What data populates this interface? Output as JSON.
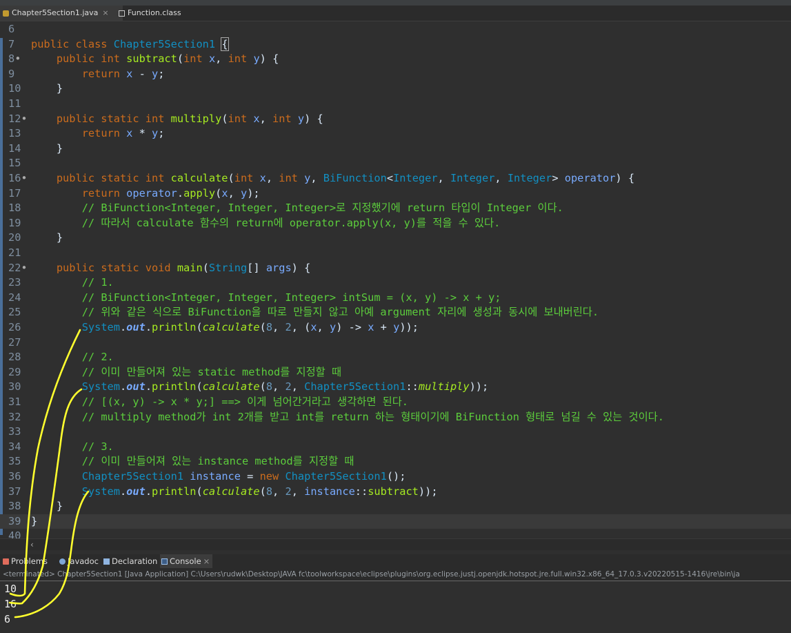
{
  "tabs": [
    {
      "label": "Chapter5Section1.java",
      "active": true,
      "closable": true,
      "icon": "java-file-icon"
    },
    {
      "label": "Function.class",
      "active": false,
      "closable": false,
      "icon": "class-file-icon"
    }
  ],
  "code_lines": [
    {
      "n": "6",
      "html": ""
    },
    {
      "n": "7",
      "html": "<span class=\"kw\">public class</span> <span class=\"ty\">Chapter5Section1</span> <span style=\"outline:1px solid #aaa\">{</span>"
    },
    {
      "n": "8",
      "fold": true,
      "html": "    <span class=\"kw\">public int</span> <span class=\"fn\">subtract</span>(<span class=\"kw\">int</span> <span class=\"va\">x</span>, <span class=\"kw\">int</span> <span class=\"va\">y</span>) {"
    },
    {
      "n": "9",
      "html": "        <span class=\"kw\">return</span> <span class=\"va\">x</span> - <span class=\"va\">y</span>;"
    },
    {
      "n": "10",
      "html": "    }"
    },
    {
      "n": "11",
      "html": ""
    },
    {
      "n": "12",
      "fold": true,
      "html": "    <span class=\"kw\">public static int</span> <span class=\"fn\">multiply</span>(<span class=\"kw\">int</span> <span class=\"va\">x</span>, <span class=\"kw\">int</span> <span class=\"va\">y</span>) {"
    },
    {
      "n": "13",
      "html": "        <span class=\"kw\">return</span> <span class=\"va\">x</span> * <span class=\"va\">y</span>;"
    },
    {
      "n": "14",
      "html": "    }"
    },
    {
      "n": "15",
      "html": ""
    },
    {
      "n": "16",
      "fold": true,
      "html": "    <span class=\"kw\">public static int</span> <span class=\"fn\">calculate</span>(<span class=\"kw\">int</span> <span class=\"va\">x</span>, <span class=\"kw\">int</span> <span class=\"va\">y</span>, <span class=\"ty\">BiFunction</span>&lt;<span class=\"ty\">Integer</span>, <span class=\"ty\">Integer</span>, <span class=\"ty\">Integer</span>&gt; <span class=\"va\">operator</span>) {"
    },
    {
      "n": "17",
      "html": "        <span class=\"kw\">return</span> <span class=\"va\">operator</span>.<span class=\"fn\">apply</span>(<span class=\"va\">x</span>, <span class=\"va\">y</span>);"
    },
    {
      "n": "18",
      "html": "        <span class=\"cm\">// BiFunction&lt;Integer, Integer, Integer&gt;로 지정했기에 return 타입이 Integer 이다.</span>"
    },
    {
      "n": "19",
      "html": "        <span class=\"cm\">// 따라서 calculate 함수의 return에 operator.apply(x, y)를 적을 수 있다.</span>"
    },
    {
      "n": "20",
      "html": "    }"
    },
    {
      "n": "21",
      "html": ""
    },
    {
      "n": "22",
      "fold": true,
      "html": "    <span class=\"kw\">public static void</span> <span class=\"fn\">main</span>(<span class=\"ty\">String</span>[] <span class=\"va\">args</span>) {"
    },
    {
      "n": "23",
      "html": "        <span class=\"cm\">// 1.</span>"
    },
    {
      "n": "24",
      "html": "        <span class=\"cm\">// BiFunction&lt;Integer, Integer, Integer&gt; intSum = (x, y) -&gt; x + y;</span>"
    },
    {
      "n": "25",
      "html": "        <span class=\"cm\">// 위와 같은 식으로 BiFunction을 따로 만들지 않고 아예 argument 자리에 생성과 동시에 보내버린다.</span>"
    },
    {
      "n": "26",
      "html": "        <span class=\"ty\">System</span>.<span class=\"va it bo\">out</span>.<span class=\"fn\">println</span>(<span class=\"fn it\">calculate</span>(<span class=\"nu\">8</span>, <span class=\"nu\">2</span>, (<span class=\"va\">x</span>, <span class=\"va\">y</span>) -&gt; <span class=\"va\">x</span> + <span class=\"va\">y</span>));"
    },
    {
      "n": "27",
      "html": ""
    },
    {
      "n": "28",
      "html": "        <span class=\"cm\">// 2.</span>"
    },
    {
      "n": "29",
      "html": "        <span class=\"cm\">// 이미 만들어져 있는 static method를 지정할 때</span>"
    },
    {
      "n": "30",
      "html": "        <span class=\"ty\">System</span>.<span class=\"va it bo\">out</span>.<span class=\"fn\">println</span>(<span class=\"fn it\">calculate</span>(<span class=\"nu\">8</span>, <span class=\"nu\">2</span>, <span class=\"ty\">Chapter5Section1</span>::<span class=\"fn it\">multiply</span>));"
    },
    {
      "n": "31",
      "html": "        <span class=\"cm\">// [(x, y) -&gt; x * y;] ==&gt; 이게 넘어간거라고 생각하면 된다.</span>"
    },
    {
      "n": "32",
      "html": "        <span class=\"cm\">// multiply method가 int 2개를 받고 int를 return 하는 형태이기에 BiFunction 형태로 넘길 수 있는 것이다.</span>"
    },
    {
      "n": "33",
      "html": ""
    },
    {
      "n": "34",
      "html": "        <span class=\"cm\">// 3.</span>"
    },
    {
      "n": "35",
      "html": "        <span class=\"cm\">// 이미 만들어져 있는 instance method를 지정할 때</span>"
    },
    {
      "n": "36",
      "html": "        <span class=\"ty\">Chapter5Section1</span> <span class=\"va\">instance</span> = <span class=\"kw\">new</span> <span class=\"ty\">Chapter5Section1</span>();"
    },
    {
      "n": "37",
      "html": "        <span class=\"ty\">System</span>.<span class=\"va it bo\">out</span>.<span class=\"fn\">println</span>(<span class=\"fn it\">calculate</span>(<span class=\"nu\">8</span>, <span class=\"nu\">2</span>, <span class=\"va\">instance</span>::<span class=\"fn\">subtract</span>));"
    },
    {
      "n": "38",
      "html": "    }"
    },
    {
      "n": "39",
      "html": "}"
    },
    {
      "n": "40",
      "html": ""
    }
  ],
  "console_tabs": [
    {
      "label": "Problems",
      "icon": "problems-icon"
    },
    {
      "label": "Javadoc",
      "icon": "javadoc-icon"
    },
    {
      "label": "Declaration",
      "icon": "declaration-icon"
    },
    {
      "label": "Console",
      "icon": "console-icon",
      "active": true,
      "closable": true
    }
  ],
  "console_status": "<terminated> Chapter5Section1 [Java Application] C:\\Users\\rudwk\\Desktop\\JAVA fc\\toolworkspace\\eclipse\\plugins\\org.eclipse.justj.openjdk.hotspot.jre.full.win32.x86_64_17.0.3.v20220515-1416\\jre\\bin\\ja",
  "console_output": [
    "10",
    "16",
    "6"
  ],
  "colors": {
    "background": "#2f2f2f",
    "keyword": "#cc6c1d",
    "type": "#1290c3",
    "method": "#a7ec21",
    "variable": "#79abff",
    "comment": "#5ccd3c",
    "annotation": "#ffff2e"
  },
  "icons": {
    "close": "close-icon",
    "scroll_left": "chevron-left-icon"
  }
}
